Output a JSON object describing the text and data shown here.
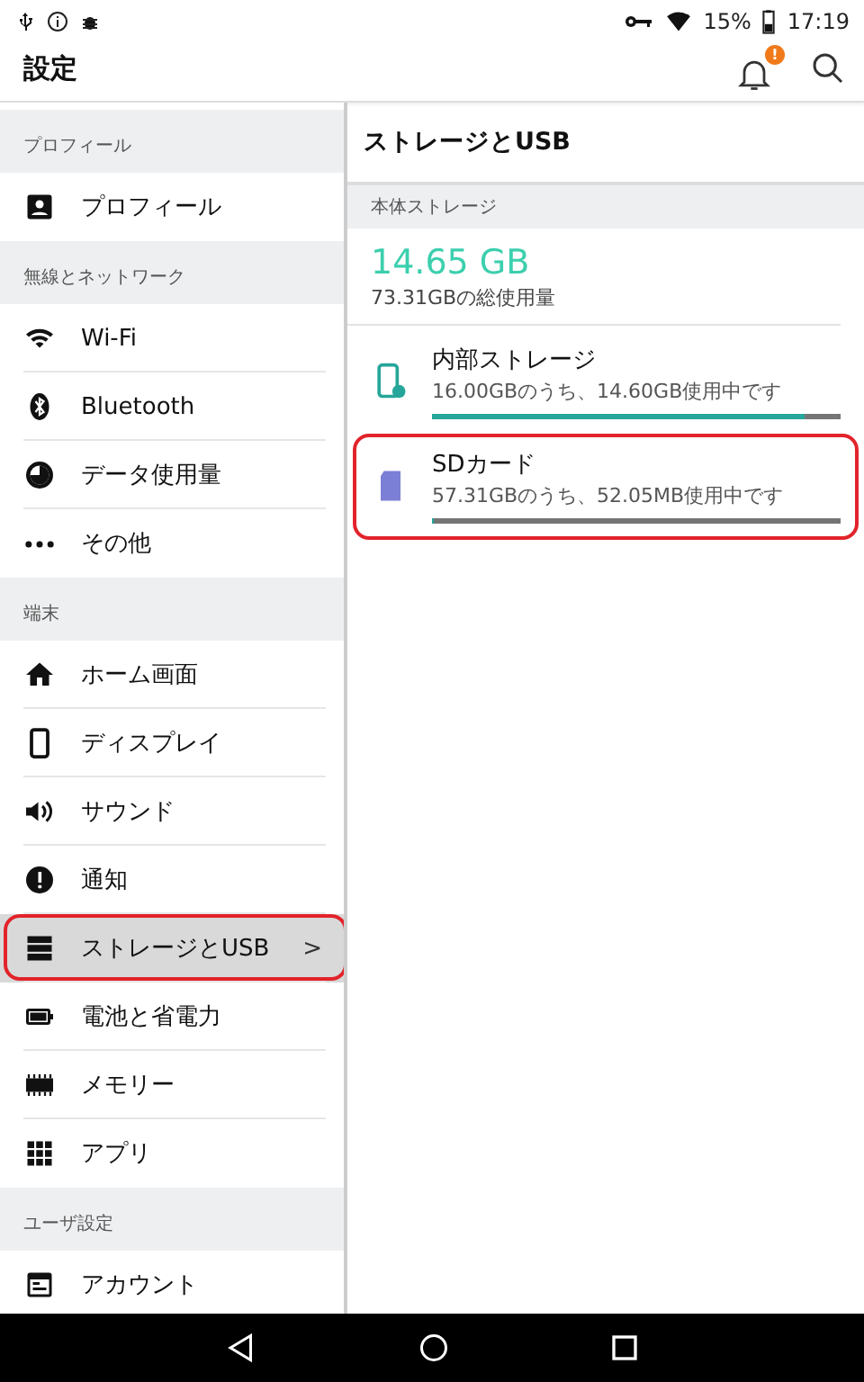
{
  "status_bar": {
    "battery": "15%",
    "time": "17:19"
  },
  "app_bar": {
    "title": "設定",
    "notification_badge": "!"
  },
  "sidebar": {
    "sections": [
      {
        "title": "プロフィール",
        "items": [
          {
            "label": "プロフィール",
            "kind": "profile",
            "selected": false,
            "highlighted": false
          }
        ]
      },
      {
        "title": "無線とネットワーク",
        "items": [
          {
            "label": "Wi-Fi",
            "kind": "wifi",
            "selected": false,
            "highlighted": false
          },
          {
            "label": "Bluetooth",
            "kind": "bluetooth",
            "selected": false,
            "highlighted": false
          },
          {
            "label": "データ使用量",
            "kind": "data",
            "selected": false,
            "highlighted": false
          },
          {
            "label": "その他",
            "kind": "more",
            "selected": false,
            "highlighted": false
          }
        ]
      },
      {
        "title": "端末",
        "items": [
          {
            "label": "ホーム画面",
            "kind": "home",
            "selected": false,
            "highlighted": false
          },
          {
            "label": "ディスプレイ",
            "kind": "display",
            "selected": false,
            "highlighted": false
          },
          {
            "label": "サウンド",
            "kind": "sound",
            "selected": false,
            "highlighted": false
          },
          {
            "label": "通知",
            "kind": "notice",
            "selected": false,
            "highlighted": false
          },
          {
            "label": "ストレージとUSB",
            "kind": "storage",
            "selected": true,
            "highlighted": true,
            "chevron": ">"
          },
          {
            "label": "電池と省電力",
            "kind": "battery",
            "selected": false,
            "highlighted": false
          },
          {
            "label": "メモリー",
            "kind": "memory",
            "selected": false,
            "highlighted": false
          },
          {
            "label": "アプリ",
            "kind": "apps",
            "selected": false,
            "highlighted": false
          }
        ]
      },
      {
        "title": "ユーザ設定",
        "items": [
          {
            "label": "アカウント",
            "kind": "account",
            "selected": false,
            "highlighted": false
          }
        ]
      }
    ]
  },
  "detail": {
    "title": "ストレージとUSB",
    "section": "本体ストレージ",
    "total_used": "14.65 GB",
    "total_caption": "73.31GBの総使用量",
    "volumes": [
      {
        "name": "内部ストレージ",
        "usage": "16.00GBのうち、14.60GB使用中です",
        "kind": "phone",
        "level": 0.91,
        "color": "#26a69a",
        "highlighted": false
      },
      {
        "name": "SDカード",
        "usage": "57.31GBのうち、52.05MB使用中です",
        "kind": "sdcard",
        "level": 0.001,
        "color": "#7b7fd6",
        "highlighted": true
      }
    ]
  }
}
